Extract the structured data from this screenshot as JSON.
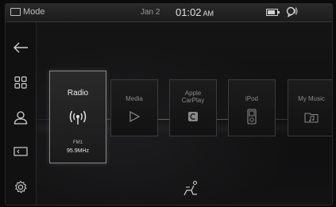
{
  "status": {
    "mode_label": "Mode",
    "date": "Jan 2",
    "time": "01:02",
    "ampm": "AM",
    "battery_icon": "battery-icon",
    "voice_icon": "voice-recognition-icon"
  },
  "sidebar": {
    "items": [
      {
        "name": "back",
        "icon": "back-arrow-icon"
      },
      {
        "name": "apps",
        "icon": "grid-icon"
      },
      {
        "name": "profile",
        "icon": "person-icon"
      },
      {
        "name": "display",
        "icon": "screen-icon"
      },
      {
        "name": "settings",
        "icon": "gear-icon"
      }
    ]
  },
  "tiles": [
    {
      "label": "Radio",
      "band": "FM1",
      "freq": "95.9MHz",
      "icon": "radio-signal-icon",
      "active": true
    },
    {
      "label": "Media",
      "icon": "play-icon",
      "active": false
    },
    {
      "label": "Apple CarPlay",
      "line1": "Apple",
      "line2": "CarPlay",
      "icon": "carplay-icon",
      "active": false
    },
    {
      "label": "iPod",
      "icon": "ipod-icon",
      "active": false
    },
    {
      "label": "My Music",
      "icon": "music-folder-icon",
      "active": false
    }
  ],
  "bottom": {
    "icon": "seat-icon"
  }
}
